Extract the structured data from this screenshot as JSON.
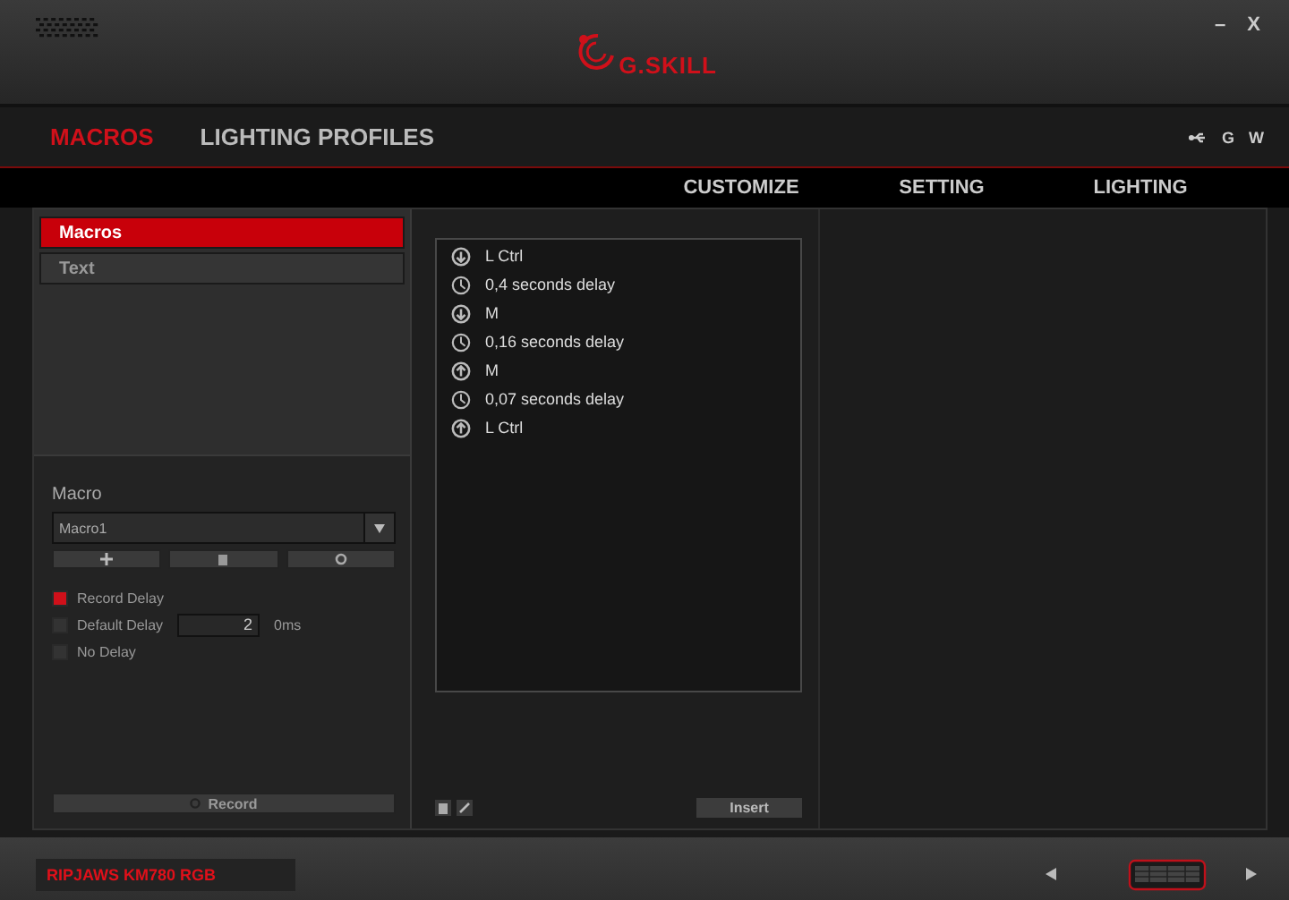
{
  "window": {
    "logo_text": "G.SKILL",
    "minimize": "–",
    "close": "X"
  },
  "tabs": [
    {
      "label": "MACROS",
      "selected": true
    },
    {
      "label": "LIGHTING PROFILES",
      "selected": false
    }
  ],
  "top_links": [
    "G",
    "W"
  ],
  "subnav": [
    {
      "label": "CUSTOMIZE",
      "selected": false
    },
    {
      "label": "SETTING",
      "selected": false
    },
    {
      "label": "LIGHTING",
      "selected": false
    }
  ],
  "sidebar": {
    "items": [
      {
        "label": "Macros",
        "selected": true
      },
      {
        "label": "Text",
        "selected": false
      }
    ]
  },
  "macro": {
    "heading": "Macro",
    "dropdown_value": "Macro1",
    "options": [
      {
        "label": "Record Delay",
        "checked": true
      },
      {
        "label": "Default Delay",
        "checked": false
      },
      {
        "label": "No Delay",
        "checked": false
      }
    ],
    "delay_value": "2",
    "delay_unit": "0ms",
    "record_label": "Record"
  },
  "steps": [
    {
      "kind": "down",
      "text": "L Ctrl"
    },
    {
      "kind": "delay",
      "text": "0,4 seconds delay"
    },
    {
      "kind": "down",
      "text": "M"
    },
    {
      "kind": "delay",
      "text": "0,16 seconds delay"
    },
    {
      "kind": "up",
      "text": "M"
    },
    {
      "kind": "delay",
      "text": "0,07 seconds delay"
    },
    {
      "kind": "up",
      "text": "L Ctrl"
    }
  ],
  "insert_label": "Insert",
  "footer": {
    "device_name": "RIPJAWS KM780 RGB"
  }
}
